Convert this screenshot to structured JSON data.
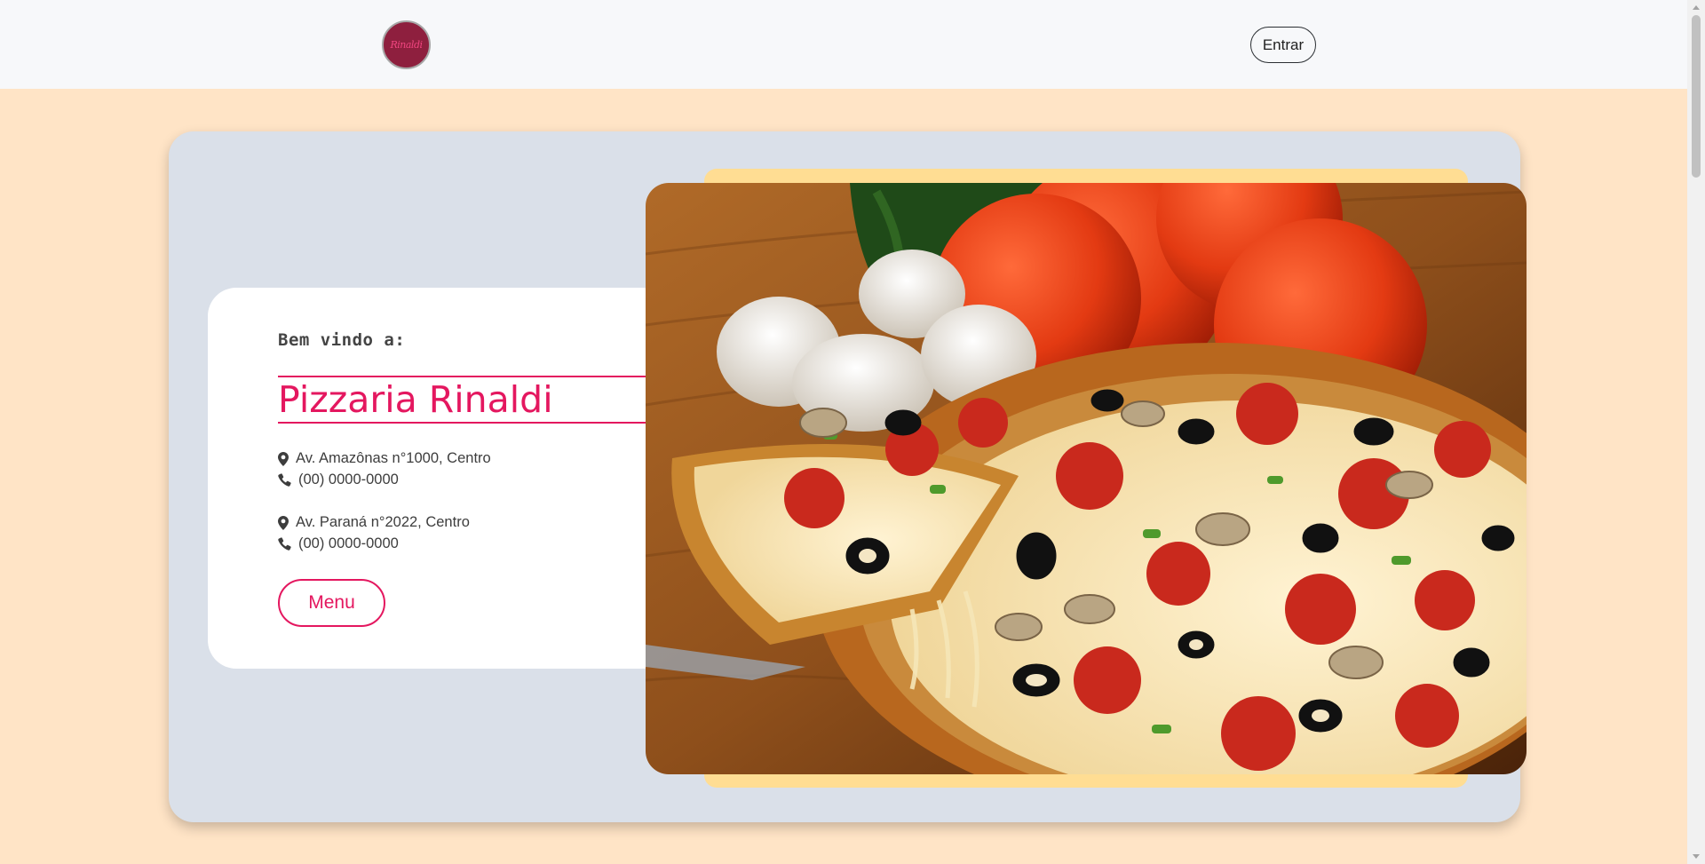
{
  "nav": {
    "logo_text": "Rinaldi",
    "login_label": "Entrar"
  },
  "hero": {
    "welcome": "Bem vindo a:",
    "title": "Pizzaria Rinaldi",
    "locations": [
      {
        "address": "Av. Amazônas n°1000, Centro",
        "phone": "(00) 0000-0000"
      },
      {
        "address": "Av. Paraná n°2022, Centro",
        "phone": "(00) 0000-0000"
      }
    ],
    "menu_label": "Menu"
  },
  "colors": {
    "accent": "#e4175f",
    "page_background": "#ffe4c6",
    "hero_background": "#dae0e9",
    "frame_yellow": "#ffdd93"
  },
  "icons": [
    "map-pin-icon",
    "phone-icon"
  ]
}
